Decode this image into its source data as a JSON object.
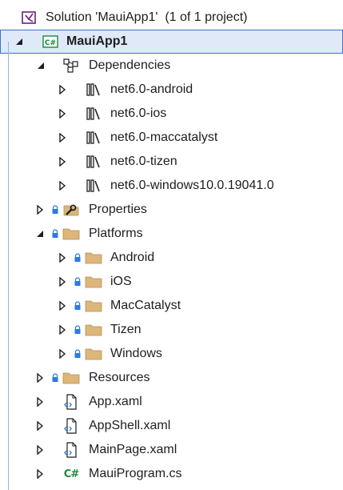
{
  "solution": {
    "label": "Solution 'MauiApp1'  (1 of 1 project)",
    "icon": "visual-studio-solution-icon"
  },
  "project": {
    "label": "MauiApp1",
    "icon": "csharp-project-icon",
    "badge": "C#"
  },
  "dependencies": {
    "label": "Dependencies",
    "icon": "dependencies-icon",
    "frameworks": [
      {
        "label": "net6.0-android"
      },
      {
        "label": "net6.0-ios"
      },
      {
        "label": "net6.0-maccatalyst"
      },
      {
        "label": "net6.0-tizen"
      },
      {
        "label": "net6.0-windows10.0.19041.0"
      }
    ]
  },
  "properties": {
    "label": "Properties",
    "icon": "properties-wrench-icon"
  },
  "platforms": {
    "label": "Platforms",
    "icon": "folder-icon",
    "children": [
      {
        "label": "Android"
      },
      {
        "label": "iOS"
      },
      {
        "label": "MacCatalyst"
      },
      {
        "label": "Tizen"
      },
      {
        "label": "Windows"
      }
    ]
  },
  "resources": {
    "label": "Resources",
    "icon": "folder-icon"
  },
  "files": [
    {
      "label": "App.xaml",
      "icon": "xaml-file-icon"
    },
    {
      "label": "AppShell.xaml",
      "icon": "xaml-file-icon"
    },
    {
      "label": "MainPage.xaml",
      "icon": "xaml-file-icon"
    },
    {
      "label": "MauiProgram.cs",
      "icon": "csharp-file-icon",
      "badge": "C#"
    }
  ],
  "colors": {
    "selection_bg": "#dfe9f8",
    "selection_border": "#3b73c8",
    "folder": "#dcb67a",
    "csharp_green": "#178c3b",
    "vs_purple": "#68217a",
    "lock_blue": "#2c7be0",
    "text": "#1e1e1e"
  }
}
